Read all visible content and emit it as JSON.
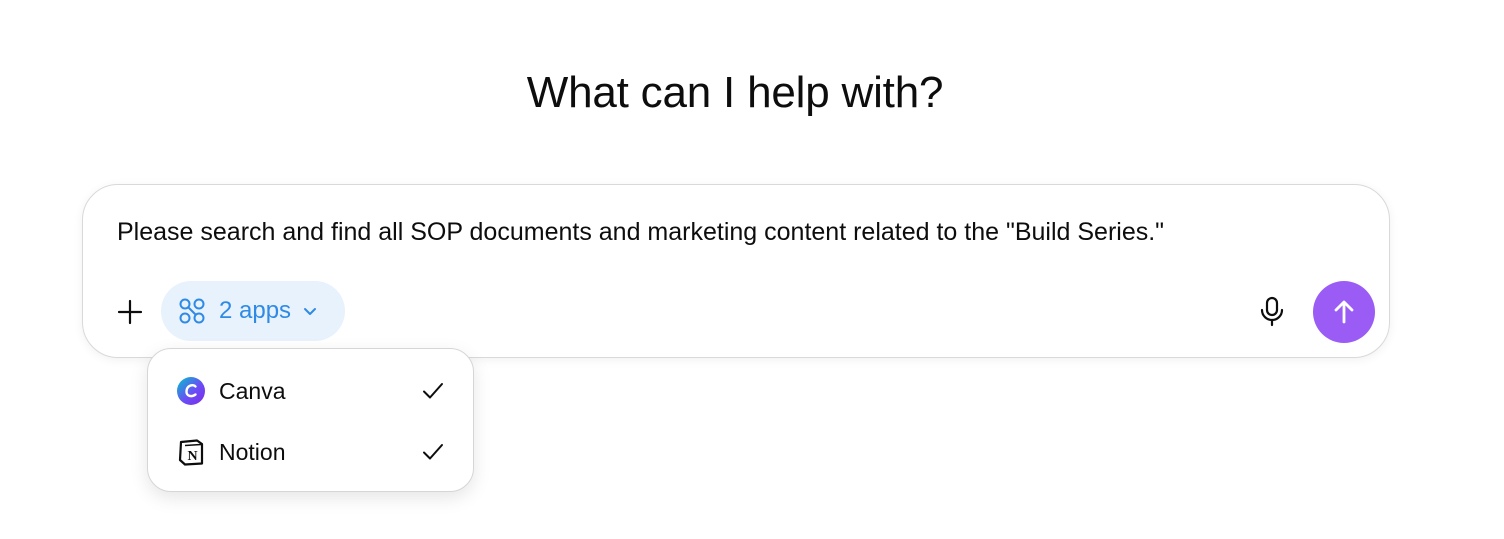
{
  "heading": "What can I help with?",
  "composer": {
    "prompt_text": "Please search and find all SOP documents and marketing content related to the \"Build Series.\"",
    "apps_label": "2 apps",
    "accent_color": "#2f8ae5",
    "send_color": "#9a5cf5"
  },
  "apps_menu": {
    "items": [
      {
        "label": "Canva",
        "checked": true,
        "icon": "canva-icon"
      },
      {
        "label": "Notion",
        "checked": true,
        "icon": "notion-icon"
      }
    ]
  }
}
